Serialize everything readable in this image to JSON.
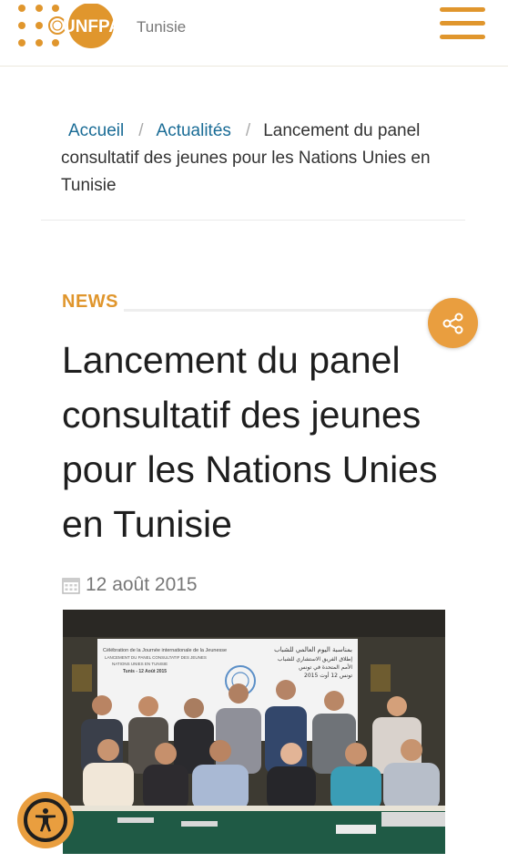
{
  "header": {
    "logo_text": "UNFPA",
    "country": "Tunisie",
    "menu_icon": "hamburger-menu-icon",
    "accent_color": "#e0962d"
  },
  "breadcrumb": {
    "home": "Accueil",
    "news": "Actualités",
    "separator": "/",
    "current": "Lancement du panel consultatif des jeunes pour les Nations Unies en Tunisie"
  },
  "article": {
    "category": "NEWS",
    "title": "Lancement du panel consultatif des jeunes pour les Nations Unies en Tunisie",
    "date": "12 août 2015",
    "share_icon": "share-icon",
    "calendar_icon": "calendar-icon"
  },
  "photo": {
    "banner_left_title": "Célébration de la Journée internationale de la Jeunesse",
    "banner_left_sub": "LANCEMENT DU PANEL CONSULTATIF DES JEUNES",
    "banner_left_sub2": "NATIONS UNIES EN TUNISIE",
    "banner_left_place": "Tunis - 12 Août 2015",
    "banner_right_title": "بمناسبة اليوم العالمي للشباب",
    "banner_right_sub": "إطلاق الفريق الاستشاري للشباب",
    "banner_right_sub2": "الأمم المتحدة في تونس",
    "banner_right_place": "تونس 12 أوت 2015"
  },
  "accessibility": {
    "icon": "accessibility-icon"
  }
}
